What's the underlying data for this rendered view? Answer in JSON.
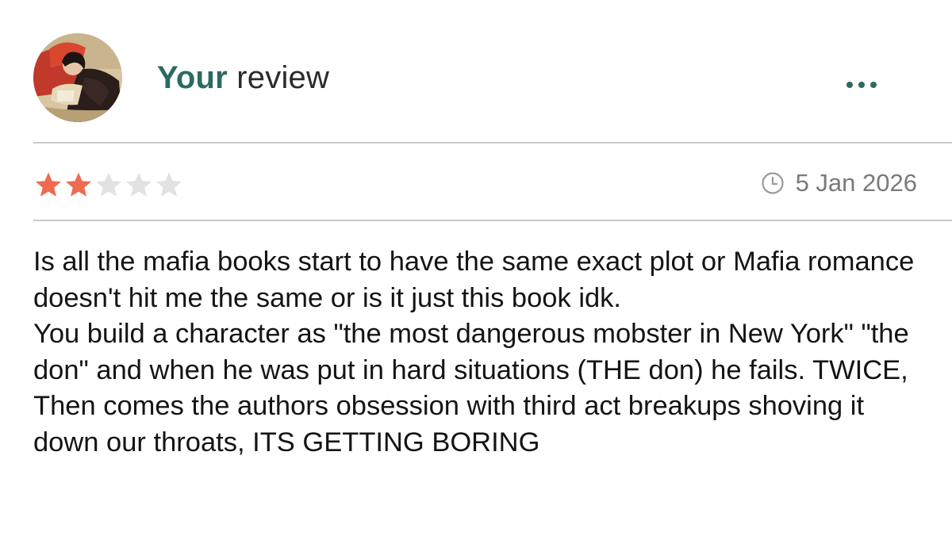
{
  "header": {
    "avatar_icon": "user-avatar-photo",
    "title_accent": "Your",
    "title_rest": "review",
    "more_icon": "ellipsis-icon",
    "accent_color": "#2c6a62"
  },
  "rating": {
    "value": 2,
    "max": 5,
    "filled_color": "#ef6b50",
    "empty_color": "#e2e2e2"
  },
  "meta": {
    "clock_icon": "clock-icon",
    "date": "5 Jan 2026"
  },
  "review": {
    "paragraphs": [
      "Is all the mafia books start to have the same exact plot or Mafia romance doesn't hit me the same or is it just this book idk.",
      "You build a character as \"the most dangerous mobster in New York\" \"the don\" and when he was put in hard situations (THE don) he fails. TWICE, Then comes the authors obsession with third act breakups shoving it down our throats, ITS GETTING BORING"
    ]
  }
}
